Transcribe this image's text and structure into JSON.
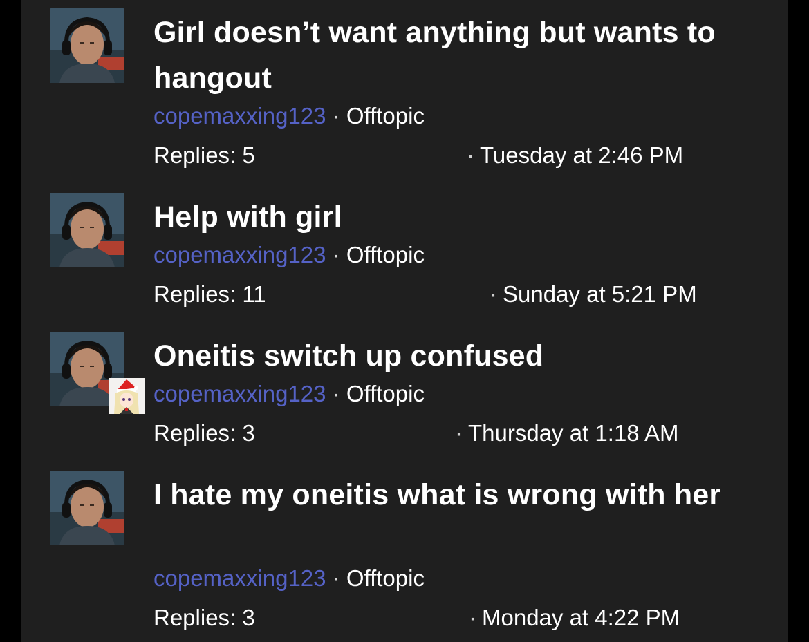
{
  "threads": [
    {
      "title": "Girl doesn’t want anything but wants to hangout",
      "author": "copemaxxing123",
      "separator": "·",
      "forum": "Offtopic",
      "replies_label": "Replies: 5",
      "date": "Tuesday at 2:46 PM",
      "has_badge_avatar": false
    },
    {
      "title": "Help with girl",
      "author": "copemaxxing123",
      "separator": "·",
      "forum": "Offtopic",
      "replies_label": "Replies: 11",
      "date": "Sunday at 5:21 PM",
      "has_badge_avatar": false
    },
    {
      "title": "Oneitis switch up confused",
      "author": "copemaxxing123",
      "separator": "·",
      "forum": "Offtopic",
      "replies_label": "Replies: 3",
      "date": "Thursday at 1:18 AM",
      "has_badge_avatar": true
    },
    {
      "title": "I hate my oneitis what is wrong with her",
      "author": "copemaxxing123",
      "separator": "·",
      "forum": "Offtopic",
      "replies_label": "Replies: 3",
      "date": "Monday at 4:22 PM",
      "has_badge_avatar": false
    }
  ],
  "date_dot": "·",
  "colors": {
    "background": "#000000",
    "panel": "#1f1f1f",
    "author_link": "#5562c6",
    "text": "#ffffff"
  }
}
